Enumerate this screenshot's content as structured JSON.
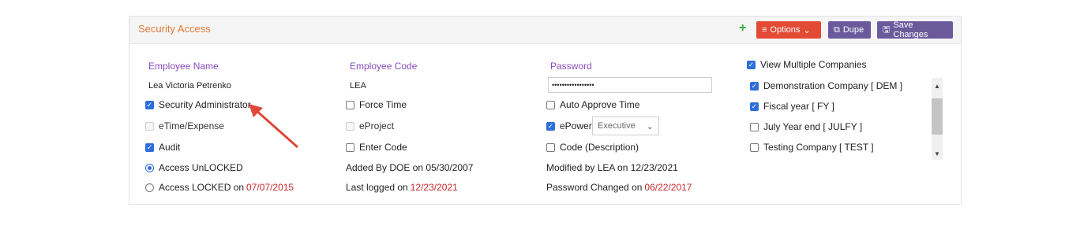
{
  "panel": {
    "title": "Security Access",
    "options_label": "Options",
    "dupe_label": "Dupe",
    "save_label": "Save Changes"
  },
  "col1": {
    "employee_name_label": "Employee Name",
    "employee_name_value": "Lea Victoria Petrenko",
    "security_admin_label": "Security Administrator",
    "etime_label": "eTime/Expense",
    "audit_label": "Audit",
    "access_unlocked_label": "Access UnLOCKED",
    "access_locked_label": "Access LOCKED on",
    "access_locked_date": "07/07/2015"
  },
  "col2": {
    "employee_code_label": "Employee Code",
    "employee_code_value": "LEA",
    "force_time_label": "Force Time",
    "eproject_label": "eProject",
    "enter_code_label": "Enter Code",
    "added_by": "Added By DOE on 05/30/2007",
    "last_logged_label": "Last logged on",
    "last_logged_date": "12/23/2021"
  },
  "col3": {
    "password_label": "Password",
    "password_value": "•••••••••••••••••",
    "auto_approve_label": "Auto Approve Time",
    "epower_label": "ePower",
    "epower_select": "Executive",
    "code_desc_label": "Code (Description)",
    "modified_by": "Modified by LEA on 12/23/2021",
    "pw_changed_label": "Password Changed on",
    "pw_changed_date": "06/22/2017"
  },
  "col4": {
    "view_multiple_label": "View Multiple Companies",
    "companies": [
      {
        "label": "Demonstration Company [ DEM ]",
        "checked": true
      },
      {
        "label": "Fiscal year [ FY ]",
        "checked": true
      },
      {
        "label": "July Year end [ JULFY ]",
        "checked": false
      },
      {
        "label": "Testing Company [ TEST ]",
        "checked": false
      }
    ]
  }
}
